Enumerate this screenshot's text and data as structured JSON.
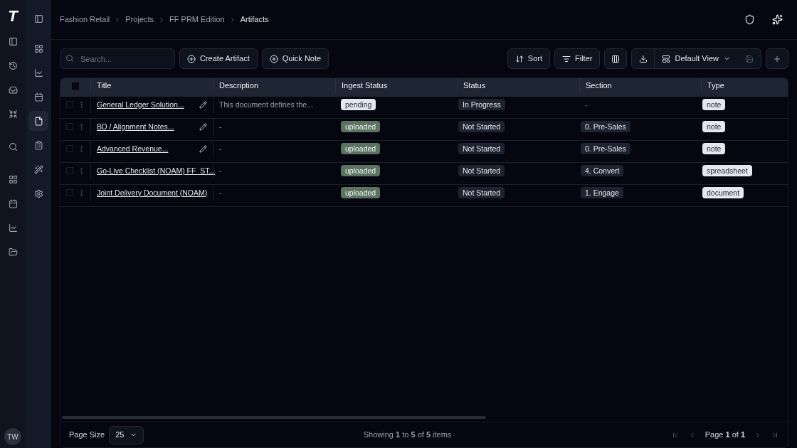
{
  "rail": {
    "logo": "T",
    "icons": [
      {
        "kind": "panel"
      },
      {
        "kind": "history"
      },
      {
        "kind": "inbox"
      },
      {
        "kind": "shrink"
      },
      {
        "kind": "search"
      },
      {
        "kind": "grid"
      },
      {
        "kind": "calendar"
      },
      {
        "kind": "chart"
      },
      {
        "kind": "folder"
      }
    ],
    "avatar": "TW"
  },
  "nav": [
    {
      "kind": "panel",
      "selected": false
    },
    {
      "kind": "grid",
      "selected": false
    },
    {
      "kind": "chart",
      "selected": false
    },
    {
      "kind": "calendar",
      "selected": false
    },
    {
      "kind": "file",
      "selected": true
    },
    {
      "kind": "clipboard",
      "selected": false
    },
    {
      "kind": "wand",
      "selected": false
    },
    {
      "kind": "gear",
      "selected": false
    }
  ],
  "breadcrumb": [
    "Fashion Retail",
    "Projects",
    "FF PRM Edition",
    "Artifacts"
  ],
  "toolbar": {
    "search": {
      "placeholder": "Search..."
    },
    "create": "Create Artifact",
    "quick_note": "Quick Note",
    "sort": "Sort",
    "filter": "Filter",
    "view": "Default View"
  },
  "table": {
    "select_all_checked": false,
    "columns": [
      "Title",
      "Description",
      "Ingest Status",
      "Status",
      "Section",
      "Type"
    ],
    "rows": [
      {
        "checked": false,
        "title": "General Ledger Solution...",
        "editable": true,
        "description": "This document defines the...",
        "ingest": {
          "label": "pending",
          "kind": "pending"
        },
        "status": "In Progress",
        "section": {
          "label": "-",
          "badge": false
        },
        "type": "note"
      },
      {
        "checked": false,
        "title": "BD / Alignment Notes...",
        "editable": true,
        "description": "-",
        "ingest": {
          "label": "uploaded",
          "kind": "uploaded"
        },
        "status": "Not Started",
        "section": {
          "label": "0. Pre-Sales",
          "badge": true
        },
        "type": "note"
      },
      {
        "checked": false,
        "title": "Advanced Revenue...",
        "editable": true,
        "description": "-",
        "ingest": {
          "label": "uploaded",
          "kind": "uploaded"
        },
        "status": "Not Started",
        "section": {
          "label": "0. Pre-Sales",
          "badge": true
        },
        "type": "note"
      },
      {
        "checked": false,
        "title": "Go-Live Checklist (NOAM) FF_ST...",
        "editable": false,
        "description": "-",
        "ingest": {
          "label": "uploaded",
          "kind": "uploaded"
        },
        "status": "Not Started",
        "section": {
          "label": "4. Convert",
          "badge": true
        },
        "type": "spreadsheet"
      },
      {
        "checked": false,
        "title": "Joint Delivery Document (NOAM)",
        "editable": false,
        "description": "-",
        "ingest": {
          "label": "uploaded",
          "kind": "uploaded"
        },
        "status": "Not Started",
        "section": {
          "label": "1. Engage",
          "badge": true
        },
        "type": "document"
      }
    ]
  },
  "footer": {
    "page_size_label": "Page Size",
    "page_size": "25",
    "showing": "Showing **1** to **5** of **5** items",
    "page": "Page **1** of **1**"
  }
}
